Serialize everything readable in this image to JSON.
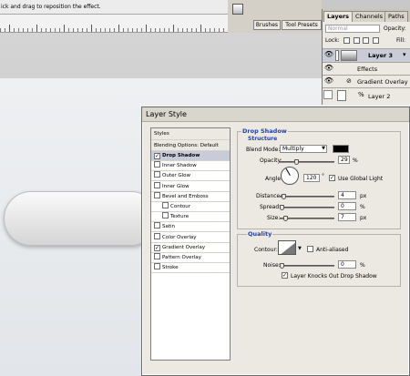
{
  "statusbar": {
    "hint": "ick and drag to reposition the effect."
  },
  "toolbar": {
    "brushes_tab": "Brushes",
    "tool_presets_tab": "Tool Presets"
  },
  "layers_panel": {
    "tabs": [
      "Layers",
      "Channels",
      "Paths"
    ],
    "blend_mode": "Normal",
    "opacity_label": "Opacity:",
    "lock_label": "Lock:",
    "fill_label": "Fill:",
    "layer3": "Layer 3",
    "effects_label": "Effects",
    "gradient_overlay_label": "Gradient Overlay",
    "layer2": "Layer 2"
  },
  "dialog": {
    "title": "Layer Style",
    "styles_header": "Styles",
    "blending_options": "Blending Options: Default",
    "items": [
      {
        "label": "Drop Shadow",
        "checked": true,
        "selected": true
      },
      {
        "label": "Inner Shadow",
        "checked": false
      },
      {
        "label": "Outer Glow",
        "checked": false
      },
      {
        "label": "Inner Glow",
        "checked": false
      },
      {
        "label": "Bevel and Emboss",
        "checked": false
      },
      {
        "label": "Contour",
        "checked": false,
        "indent": true
      },
      {
        "label": "Texture",
        "checked": false,
        "indent": true
      },
      {
        "label": "Satin",
        "checked": false
      },
      {
        "label": "Color Overlay",
        "checked": false
      },
      {
        "label": "Gradient Overlay",
        "checked": true
      },
      {
        "label": "Pattern Overlay",
        "checked": false
      },
      {
        "label": "Stroke",
        "checked": false
      }
    ],
    "drop_shadow": {
      "title": "Drop Shadow",
      "structure_title": "Structure",
      "blend_mode_label": "Blend Mode:",
      "blend_mode_value": "Multiply",
      "shadow_color": "#000000",
      "opacity_label": "Opacity:",
      "opacity_value": "29",
      "opacity_unit": "%",
      "angle_label": "Angle:",
      "angle_value": "120",
      "angle_unit": "°",
      "use_global_light": "Use Global Light",
      "distance_label": "Distance:",
      "distance_value": "4",
      "distance_unit": "px",
      "spread_label": "Spread:",
      "spread_value": "0",
      "spread_unit": "%",
      "size_label": "Size:",
      "size_value": "7",
      "size_unit": "px"
    },
    "quality": {
      "title": "Quality",
      "contour_label": "Contour:",
      "anti_aliased": "Anti-aliased",
      "noise_label": "Noise:",
      "noise_value": "0",
      "noise_unit": "%",
      "knocks_out": "Layer Knocks Out Drop Shadow"
    }
  }
}
